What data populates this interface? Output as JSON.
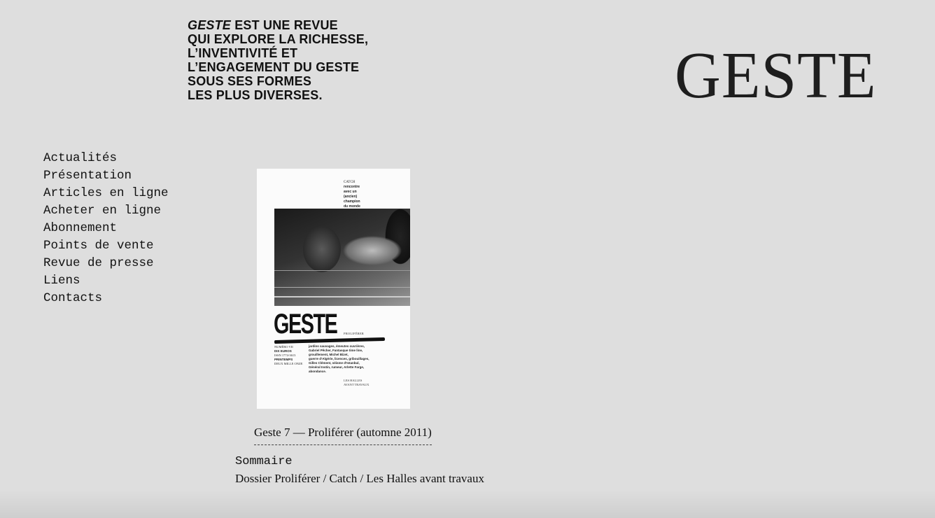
{
  "header": {
    "tagline": {
      "emphasis": "GESTE",
      "line1_rest": " EST UNE REVUE",
      "line2": "QUI EXPLORE LA RICHESSE,",
      "line3": "L’INVENTIVITÉ ET",
      "line4": "L’ENGAGEMENT DU GESTE",
      "line5": "SOUS SES FORMES",
      "line6": "LES PLUS DIVERSES."
    },
    "logo": "GESTE"
  },
  "nav": {
    "items": [
      {
        "label": "Actualités"
      },
      {
        "label": "Présentation"
      },
      {
        "label": "Articles en ligne"
      },
      {
        "label": "Acheter en ligne"
      },
      {
        "label": "Abonnement"
      },
      {
        "label": "Points de vente"
      },
      {
        "label": "Revue de presse"
      },
      {
        "label": "Liens"
      },
      {
        "label": "Contacts"
      }
    ]
  },
  "issue": {
    "cover": {
      "teaser": [
        "CATCH",
        "rencontre",
        "avec un",
        "(ancien)",
        "champion",
        "du monde"
      ],
      "masthead": "GESTE",
      "theme": "PROLIFÉRER",
      "meta": [
        "NUMÉRO VII",
        "DIX EUROS",
        "ISSN 1774-3613",
        "PRINTEMPS",
        "DEUX MILLE ONZE"
      ],
      "contents": [
        "jardins sauvages, émeutes ouvrières,",
        "Gabriel Pêcher, Fantasque time line,",
        "grouillement, Michel Bizet,",
        "guerre d’Algérie, licences, gribouillages,",
        "Gilles Clément, séisme d’Istanbul,",
        "Général Instin, rumeur, Arlette Farge,",
        "abondance."
      ],
      "footnote": [
        "LES HALLES",
        "AVANT TRAVAUX"
      ]
    },
    "caption": "Geste 7 — Proliférer (automne 2011)",
    "summary_label": "Sommaire",
    "summary_text": "Dossier Proliférer / Catch / Les Halles avant travaux"
  }
}
